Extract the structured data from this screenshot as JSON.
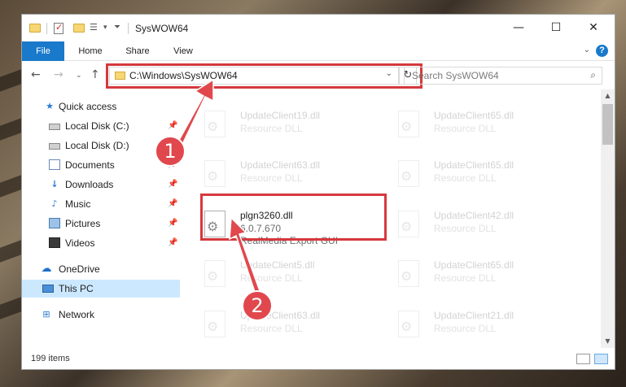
{
  "window": {
    "title": "SysWOW64",
    "controls": {
      "minimize": "—",
      "maximize": "☐",
      "close": "✕"
    }
  },
  "ribbon": {
    "tabs": [
      "File",
      "Home",
      "Share",
      "View"
    ],
    "help": "?"
  },
  "address": {
    "path": "C:\\Windows\\SysWOW64",
    "search_placeholder": "Search SysWOW64"
  },
  "nav": {
    "items": [
      {
        "label": "Quick access",
        "icon": "star-icon",
        "pinned": false
      },
      {
        "label": "Local Disk (C:)",
        "icon": "drive-icon",
        "pinned": true
      },
      {
        "label": "Local Disk (D:)",
        "icon": "drive-icon",
        "pinned": false
      },
      {
        "label": "Documents",
        "icon": "documents-icon",
        "pinned": true
      },
      {
        "label": "Downloads",
        "icon": "download-icon",
        "pinned": true
      },
      {
        "label": "Music",
        "icon": "music-icon",
        "pinned": true
      },
      {
        "label": "Pictures",
        "icon": "pictures-icon",
        "pinned": true
      },
      {
        "label": "Videos",
        "icon": "videos-icon",
        "pinned": true
      },
      {
        "label": "OneDrive",
        "icon": "cloud-icon",
        "pinned": false
      },
      {
        "label": "This PC",
        "icon": "pc-icon",
        "pinned": false,
        "selected": true
      },
      {
        "label": "Network",
        "icon": "network-icon",
        "pinned": false
      }
    ]
  },
  "files": [
    {
      "name": "UpdateClient19.dll",
      "type": "Resource DLL"
    },
    {
      "name": "UpdateClient65.dll",
      "type": "Resource DLL"
    },
    {
      "name": "UpdateClient63.dll",
      "type": "Resource DLL"
    },
    {
      "name": "UpdateClient65.dll",
      "type": "Resource DLL"
    },
    {
      "name": "plgn3260.dll",
      "version": "6.0.7.670",
      "description": "RealMedia Export GUI"
    },
    {
      "name": "UpdateClient42.dll",
      "type": "Resource DLL"
    },
    {
      "name": "UpdateClient5.dll",
      "type": "Resource DLL"
    },
    {
      "name": "UpdateClient65.dll",
      "type": "Resource DLL"
    },
    {
      "name": "UpdateClient63.dll",
      "type": "Resource DLL"
    },
    {
      "name": "UpdateClient21.dll",
      "type": "Resource DLL"
    }
  ],
  "status": {
    "items": "199 items"
  },
  "callouts": [
    "1",
    "2"
  ],
  "colors": {
    "accent": "#1979ca",
    "highlight": "#d6383d",
    "selection": "#cce8ff"
  }
}
